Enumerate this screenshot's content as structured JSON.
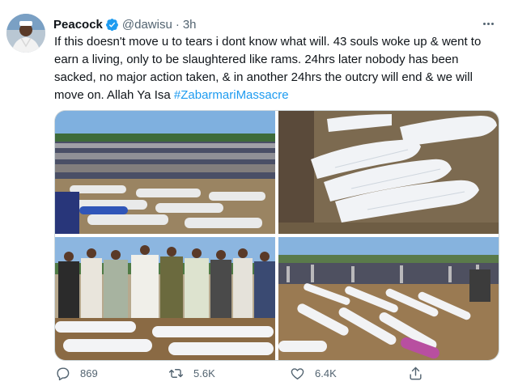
{
  "tweet": {
    "display_name": "Peacock",
    "handle": "@dawisu",
    "separator": "·",
    "time": "3h",
    "text_main": "If this doesn't move u to tears i dont know what will. 43 souls woke up & went to earn a living, only to be slaughtered like rams. 24hrs later nobody has been sacked, no major action taken, & in another 24hrs the outcry will end & we will move on. Allah Ya Isa ",
    "hashtag": "#ZabarmariMassacre"
  },
  "actions": {
    "reply_count": "869",
    "retweet_count": "5.6K",
    "like_count": "6.4K"
  },
  "colors": {
    "link": "#1d9bf0",
    "verified": "#1d9bf0",
    "muted": "#536471"
  },
  "icons": [
    "verified-badge-icon",
    "more-options-icon",
    "reply-icon",
    "retweet-icon",
    "like-icon",
    "share-icon"
  ]
}
